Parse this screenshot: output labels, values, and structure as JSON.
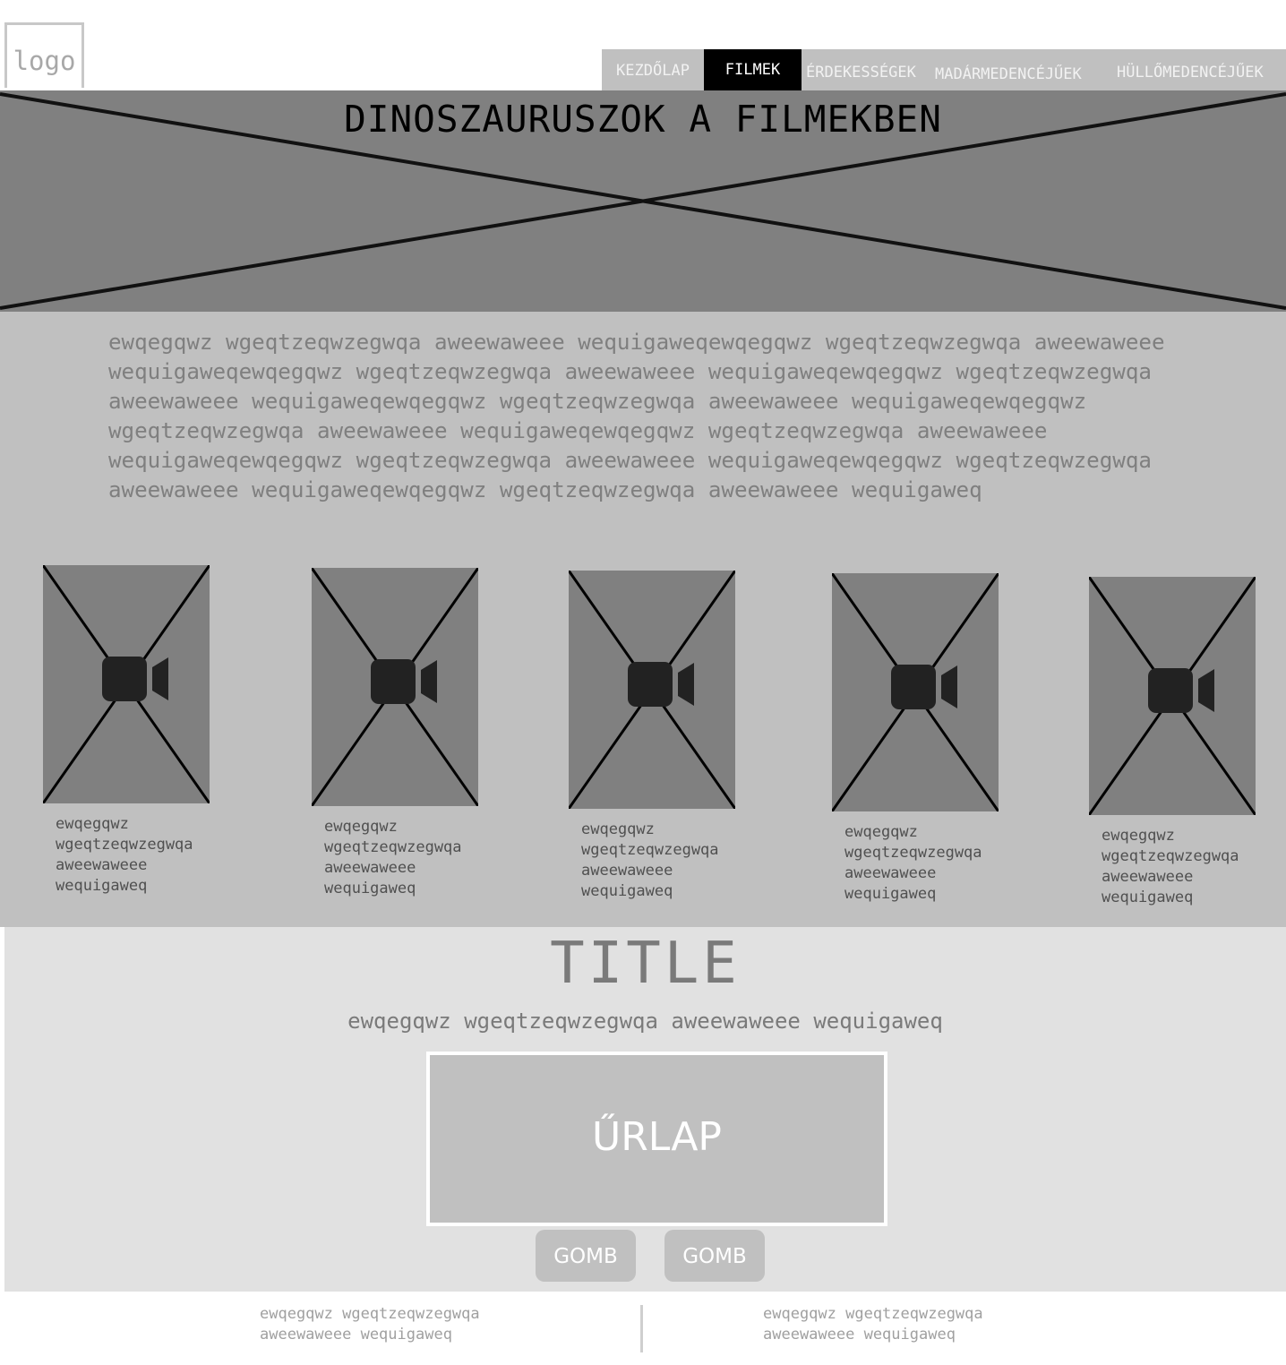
{
  "logo": {
    "text": "logo"
  },
  "nav": {
    "items": [
      {
        "label": "KEZDŐLAP",
        "active": false
      },
      {
        "label": "FILMEK",
        "active": true
      },
      {
        "label": "ÉRDEKESSÉGEK",
        "active": false
      },
      {
        "label": "MADÁRMEDENCÉJŰEK",
        "active": false
      },
      {
        "label": "HÜLLŐMEDENCÉJŰEK",
        "active": false
      }
    ]
  },
  "hero": {
    "title": "DINOSZAURUSZOK A FILMEKBEN"
  },
  "intro": {
    "lines": [
      "ewqegqwz wgeqtzeqwzegwqa aweewaweee wequigaweqewqegqwz wgeqtzeqwzegwqa aweewaweee",
      "wequigaweqewqegqwz wgeqtzeqwzegwqa aweewaweee wequigaweqewqegqwz wgeqtzeqwzegwqa",
      "aweewaweee wequigaweqewqegqwz wgeqtzeqwzegwqa aweewaweee wequigaweqewqegqwz",
      "wgeqtzeqwzegwqa aweewaweee wequigaweqewqegqwz wgeqtzeqwzegwqa aweewaweee",
      "wequigaweqewqegqwz wgeqtzeqwzegwqa aweewaweee wequigaweqewqegqwz wgeqtzeqwzegwqa",
      "aweewaweee wequigaweqewqegqwz wgeqtzeqwzegwqa aweewaweee wequigaweq"
    ]
  },
  "movies": [
    {
      "icon": "video-camera-icon",
      "caption": [
        "ewqegqwz",
        "wgeqtzeqwzegwqa",
        "aweewaweee",
        "wequigaweq"
      ]
    },
    {
      "icon": "video-camera-icon",
      "caption": [
        "ewqegqwz",
        "wgeqtzeqwzegwqa",
        "aweewaweee",
        "wequigaweq"
      ]
    },
    {
      "icon": "video-camera-icon",
      "caption": [
        "ewqegqwz",
        "wgeqtzeqwzegwqa",
        "aweewaweee",
        "wequigaweq"
      ]
    },
    {
      "icon": "video-camera-icon",
      "caption": [
        "ewqegqwz",
        "wgeqtzeqwzegwqa",
        "aweewaweee",
        "wequigaweq"
      ]
    },
    {
      "icon": "video-camera-icon",
      "caption": [
        "ewqegqwz",
        "wgeqtzeqwzegwqa",
        "aweewaweee",
        "wequigaweq"
      ]
    }
  ],
  "form_section": {
    "title": "TITLE",
    "subtitle": "ewqegqwz wgeqtzeqwzegwqa aweewaweee wequigaweq",
    "form_label": "ŰRLAP",
    "buttons": [
      "GOMB",
      "GOMB"
    ]
  },
  "footer": {
    "columns": [
      [
        "ewqegqwz wgeqtzeqwzegwqa",
        "aweewaweee wequigaweq"
      ],
      [
        "ewqegqwz wgeqtzeqwzegwqa",
        "aweewaweee wequigaweq"
      ]
    ]
  },
  "colors": {
    "nav_bg": "#c0c0c0",
    "nav_active_bg": "#000000",
    "hero_bg": "#808080",
    "content_bg": "#c0c0c0",
    "form_section_bg": "#e1e1e1",
    "placeholder_bg": "#808080"
  }
}
